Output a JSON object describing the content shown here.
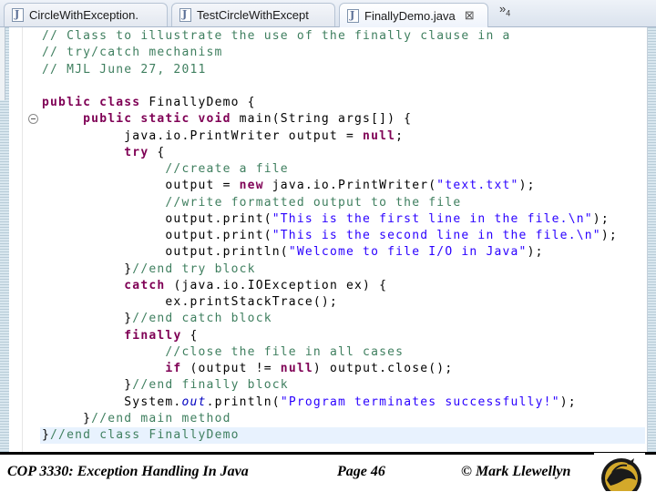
{
  "tabs": [
    {
      "label": "CircleWithException.",
      "active": false
    },
    {
      "label": "TestCircleWithExcept",
      "active": false
    },
    {
      "label": "FinallyDemo.java",
      "active": true,
      "close": "⊠"
    }
  ],
  "tab_overflow": {
    "symbol": "»",
    "count": "4"
  },
  "code_lines": [
    [
      [
        "cm",
        "// Class to illustrate the use of the finally clause in a"
      ]
    ],
    [
      [
        "cm",
        "// try/catch mechanism"
      ]
    ],
    [
      [
        "cm",
        "// MJL June 27, 2011"
      ]
    ],
    [
      [
        "",
        ""
      ]
    ],
    [
      [
        "kw",
        "public class"
      ],
      [
        "",
        " FinallyDemo {"
      ]
    ],
    [
      [
        "",
        "     "
      ],
      [
        "kw",
        "public static void"
      ],
      [
        "",
        " main(String args[]) {"
      ]
    ],
    [
      [
        "",
        "          java.io.PrintWriter output = "
      ],
      [
        "lit",
        "null"
      ],
      [
        "",
        ";"
      ]
    ],
    [
      [
        "",
        "          "
      ],
      [
        "kw",
        "try"
      ],
      [
        "",
        " {"
      ]
    ],
    [
      [
        "",
        "               "
      ],
      [
        "cm",
        "//create a file"
      ]
    ],
    [
      [
        "",
        "               output = "
      ],
      [
        "kw",
        "new"
      ],
      [
        "",
        " java.io.PrintWriter("
      ],
      [
        "st",
        "\"text.txt\""
      ],
      [
        "",
        ");"
      ]
    ],
    [
      [
        "",
        "               "
      ],
      [
        "cm",
        "//write formatted output to the file"
      ]
    ],
    [
      [
        "",
        "               output.print("
      ],
      [
        "st",
        "\"This is the first line in the file.\\n\""
      ],
      [
        "",
        ");"
      ]
    ],
    [
      [
        "",
        "               output.print("
      ],
      [
        "st",
        "\"This is the second line in the file.\\n\""
      ],
      [
        "",
        ");"
      ]
    ],
    [
      [
        "",
        "               output.println("
      ],
      [
        "st",
        "\"Welcome to file I/O in Java\""
      ],
      [
        "",
        ");"
      ]
    ],
    [
      [
        "",
        "          }"
      ],
      [
        "cm",
        "//end try block"
      ]
    ],
    [
      [
        "",
        "          "
      ],
      [
        "kw",
        "catch"
      ],
      [
        "",
        " (java.io.IOException ex) {"
      ]
    ],
    [
      [
        "",
        "               ex.printStackTrace();"
      ]
    ],
    [
      [
        "",
        "          }"
      ],
      [
        "cm",
        "//end catch block"
      ]
    ],
    [
      [
        "",
        "          "
      ],
      [
        "kw",
        "finally"
      ],
      [
        "",
        " {"
      ]
    ],
    [
      [
        "",
        "               "
      ],
      [
        "cm",
        "//close the file in all cases"
      ]
    ],
    [
      [
        "",
        "               "
      ],
      [
        "kw",
        "if"
      ],
      [
        "",
        " (output != "
      ],
      [
        "lit",
        "null"
      ],
      [
        "",
        ") output.close();"
      ]
    ],
    [
      [
        "",
        "          }"
      ],
      [
        "cm",
        "//end finally block"
      ]
    ],
    [
      [
        "",
        "          System."
      ],
      [
        "it",
        "out"
      ],
      [
        "",
        ".println("
      ],
      [
        "st",
        "\"Program terminates successfully!\""
      ],
      [
        "",
        ");"
      ]
    ],
    [
      [
        "",
        "     }"
      ],
      [
        "cm",
        "//end main method"
      ]
    ],
    [
      [
        "",
        "}"
      ],
      [
        "cm",
        "//end class FinallyDemo"
      ]
    ]
  ],
  "current_line_index": 24,
  "footer": {
    "course": "COP 3330:  Exception Handling In Java",
    "page": "Page 46",
    "author": "© Mark Llewellyn"
  },
  "colors": {
    "comment": "#3f7f5f",
    "keyword": "#7f0055",
    "string": "#2a00ff",
    "static_field": "#0000c0",
    "current_line": "#e8f2fe"
  }
}
